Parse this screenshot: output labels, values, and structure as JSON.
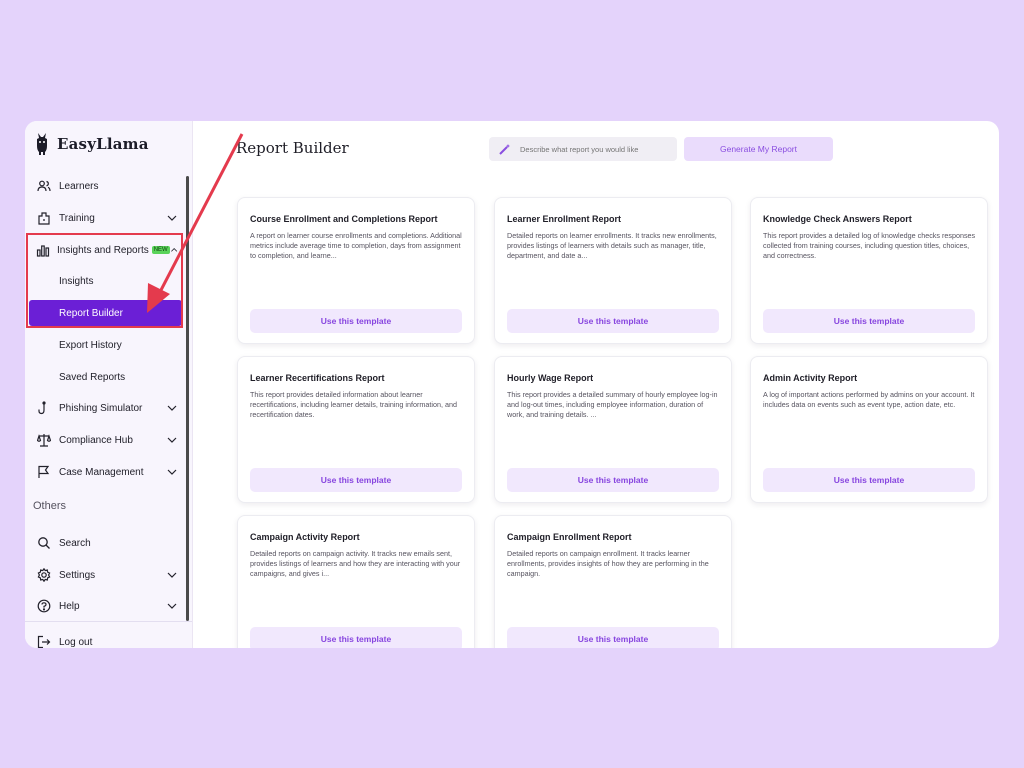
{
  "app": {
    "name": "EasyLlama"
  },
  "sidebar": {
    "items": [
      {
        "label": "Learners",
        "icon": "users-icon"
      },
      {
        "label": "Training",
        "icon": "training-icon"
      },
      {
        "label": "Insights and Reports",
        "icon": "bar-chart-icon",
        "badge": "NEW"
      },
      {
        "label": "Phishing Simulator",
        "icon": "hook-icon"
      },
      {
        "label": "Compliance Hub",
        "icon": "scale-icon"
      },
      {
        "label": "Case Management",
        "icon": "flag-icon"
      }
    ],
    "subitems": [
      "Insights",
      "Report Builder",
      "Export History",
      "Saved Reports"
    ],
    "others_title": "Others",
    "others": [
      {
        "label": "Search",
        "icon": "search-icon"
      },
      {
        "label": "Settings",
        "icon": "gear-icon"
      },
      {
        "label": "Help",
        "icon": "help-icon"
      }
    ],
    "logout": "Log out"
  },
  "main": {
    "title": "Report Builder",
    "search": {
      "placeholder": "Describe what report you would like"
    },
    "generate_label": "Generate My Report",
    "use_template_label": "Use this template",
    "cards": [
      {
        "title": "Course Enrollment and Completions Report",
        "desc": "A report on learner course enrollments and completions. Additional metrics include average time to completion, days from assignment to completion, and learne..."
      },
      {
        "title": "Learner Enrollment Report",
        "desc": "Detailed reports on learner enrollments. It tracks new enrollments, provides listings of learners with details such as manager, title, department, and date a..."
      },
      {
        "title": "Knowledge Check Answers Report",
        "desc": "This report provides a detailed log of knowledge checks responses collected from training courses, including question titles, choices, and correctness."
      },
      {
        "title": "Learner Recertifications Report",
        "desc": "This report provides detailed information about learner recertifications, including learner details, training information, and recertification dates."
      },
      {
        "title": "Hourly Wage Report",
        "desc": "This report provides a detailed summary of hourly employee log-in and log-out times, including employee information, duration of work, and training details. ..."
      },
      {
        "title": "Admin Activity Report",
        "desc": "A log of important actions performed by admins on your account. It includes data on events such as event type, action date, etc."
      },
      {
        "title": "Campaign Activity Report",
        "desc": "Detailed reports on campaign activity. It tracks new emails sent, provides listings of learners and how they are interacting with your campaigns, and gives i..."
      },
      {
        "title": "Campaign Enrollment Report",
        "desc": "Detailed reports on campaign enrollment. It tracks learner enrollments, provides insights of how they are performing in the campaign."
      }
    ]
  },
  "colors": {
    "accent": "#6b1fd6",
    "annotation": "#e43a4d",
    "background": "#e4d3fb"
  }
}
